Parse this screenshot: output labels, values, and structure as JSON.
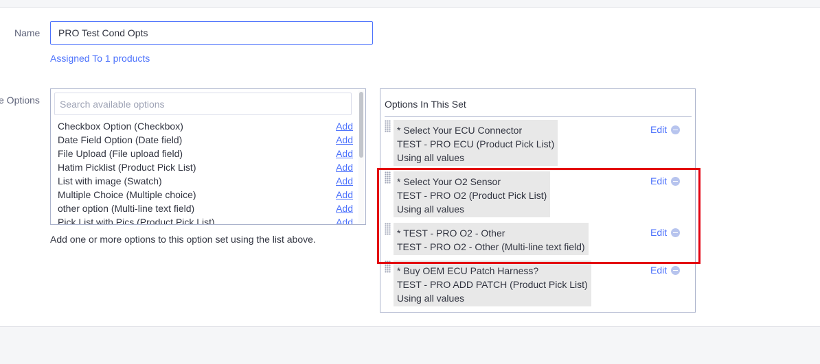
{
  "form": {
    "name_label": "Name",
    "name_value": "PRO Test Cond Opts",
    "assigned_link": "Assigned To 1 products",
    "options_label": "e Options"
  },
  "available": {
    "search_placeholder": "Search available options",
    "items": [
      {
        "label": "Checkbox Option (Checkbox)",
        "action": "Add"
      },
      {
        "label": "Date Field Option (Date field)",
        "action": "Add"
      },
      {
        "label": "File Upload (File upload field)",
        "action": "Add"
      },
      {
        "label": "Hatim Picklist (Product Pick List)",
        "action": "Add"
      },
      {
        "label": "List with image (Swatch)",
        "action": "Add"
      },
      {
        "label": "Multiple Choice (Multiple choice)",
        "action": "Add"
      },
      {
        "label": "other option (Multi-line text field)",
        "action": "Add"
      },
      {
        "label": "Pick List with Pics (Product Pick List)",
        "action": "Add"
      }
    ],
    "help_text": "Add one or more options to this option set using the list above."
  },
  "set": {
    "header": "Options In This Set",
    "items": [
      {
        "lines": [
          "* Select Your ECU Connector",
          "TEST - PRO ECU (Product Pick List)",
          "Using all values"
        ],
        "edit": "Edit"
      },
      {
        "lines": [
          "* Select Your O2 Sensor",
          "TEST - PRO O2 (Product Pick List)",
          "Using all values"
        ],
        "edit": "Edit"
      },
      {
        "lines": [
          "* TEST - PRO O2 - Other",
          "TEST - PRO O2 - Other (Multi-line text field)"
        ],
        "edit": "Edit"
      },
      {
        "lines": [
          "* Buy OEM ECU Patch Harness?",
          "TEST - PRO ADD PATCH (Product Pick List)",
          "Using all values"
        ],
        "edit": "Edit"
      }
    ]
  },
  "colors": {
    "accent": "#4b71fc",
    "highlight": "#e3000f",
    "item_bg": "#e8e8e8"
  }
}
